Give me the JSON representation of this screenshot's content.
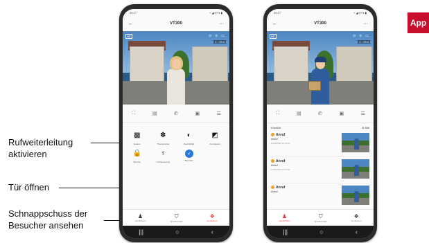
{
  "app_tab": "App",
  "callouts": [
    {
      "line1": "Rufweiterleitung",
      "line2": "aktivieren"
    },
    {
      "line1": "Tür öffnen",
      "line2": ""
    },
    {
      "line1": "Schnappschuss der",
      "line2": "Besucher ansehen"
    }
  ],
  "phone1": {
    "status_time": "09:17",
    "status_right": "⌁ ◢ 97% ▮",
    "title": "VT300",
    "back": "←",
    "menu": "···",
    "video_hd": "HD",
    "video_icons": "⊙ ⦸ ▭",
    "video_time": "1 · 23:4",
    "grid": [
      {
        "icon": "image-icon",
        "glyph": "▩",
        "label": "Galerie"
      },
      {
        "icon": "palette-icon",
        "glyph": "✽",
        "label": "Themenfarbe"
      },
      {
        "icon": "shield-icon",
        "glyph": "◐",
        "label": "Beschäftigt"
      },
      {
        "icon": "forward-call-icon",
        "glyph": "◩",
        "label": "Anrufsperre"
      },
      {
        "icon": "lock-icon",
        "glyph": "🔒",
        "label": "Sperren"
      },
      {
        "icon": "light-icon",
        "glyph": "♀",
        "label": "Lichtsteuerung"
      },
      {
        "icon": "compass-icon",
        "glyph": "✓",
        "label": "Beenden"
      }
    ],
    "nav": [
      {
        "icon": "bell-icon",
        "glyph": "♟",
        "label": "Nachrichten",
        "active": false
      },
      {
        "icon": "cart-icon",
        "glyph": "⛉",
        "label": "Speicherplatz",
        "active": false
      },
      {
        "icon": "functions-icon",
        "glyph": "❖",
        "label": "Funktionen",
        "active": true
      }
    ]
  },
  "phone2": {
    "status_time": "09:17",
    "status_right": "⌁ ◢ 97% ▮",
    "title": "VT300",
    "back": "←",
    "menu": "···",
    "video_hd": "HD",
    "video_icons": "⊙ ⦸ ▭",
    "video_time": "1 · 23:4",
    "history_title": "Kürzlich",
    "history_all": "⊜ Alle",
    "history": [
      {
        "title": "Anruf",
        "sub": "Anruf",
        "date": "11/03/2023 15:15:03"
      },
      {
        "title": "Anruf",
        "sub": "Anruf",
        "date": "11/03/2023 15:13:04"
      },
      {
        "title": "Anruf",
        "sub": "Anruf",
        "date": ""
      }
    ],
    "nav": [
      {
        "icon": "bell-icon",
        "glyph": "♟",
        "label": "Nachrichten",
        "active": true
      },
      {
        "icon": "cart-icon",
        "glyph": "⛉",
        "label": "Speicherplatz",
        "active": false
      },
      {
        "icon": "functions-icon",
        "glyph": "❖",
        "label": "Funktionen",
        "active": false
      }
    ]
  },
  "controls": [
    "⛶",
    "▤",
    "✆",
    "▣",
    "☰"
  ],
  "sysnav": [
    "|||",
    "○",
    "‹"
  ]
}
